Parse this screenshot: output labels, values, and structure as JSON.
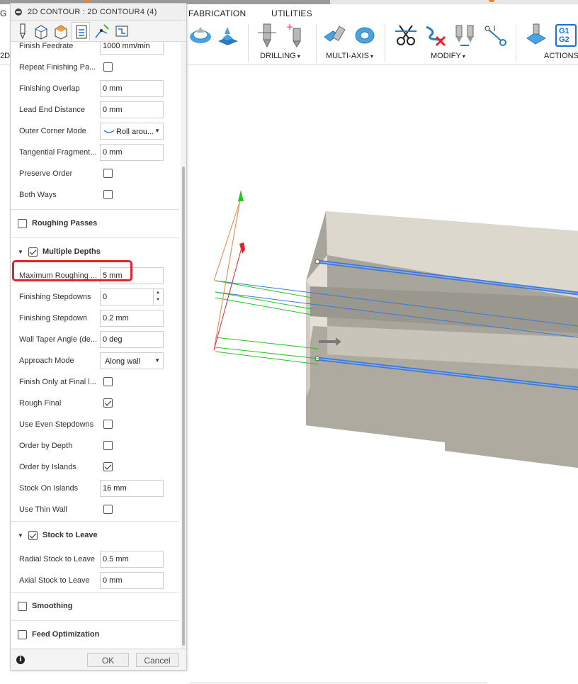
{
  "ribbon": {
    "tabs": [
      "G",
      "FABRICATION",
      "UTILITIES"
    ],
    "side_label": "2D",
    "groups": [
      {
        "label": "DRILLING",
        "caret": "▾"
      },
      {
        "label": "MULTI-AXIS",
        "caret": "▾"
      },
      {
        "label": "MODIFY",
        "caret": "▾"
      },
      {
        "label": "ACTIONS",
        "caret": ""
      }
    ],
    "g1g2": [
      "G1",
      "G2"
    ]
  },
  "panel": {
    "title": "2D CONTOUR : 2D CONTOUR4 (4)",
    "fields": [
      {
        "label": "Finish Feedrate",
        "type": "text",
        "value": "1000 mm/min"
      },
      {
        "label": "Repeat Finishing Pa...",
        "type": "checkbox",
        "checked": false
      },
      {
        "label": "Finishing Overlap",
        "type": "text",
        "value": "0 mm"
      },
      {
        "label": "Lead End Distance",
        "type": "text",
        "value": "0 mm"
      },
      {
        "label": "Outer Corner Mode",
        "type": "select",
        "value": "Roll arou..."
      },
      {
        "label": "Tangential Fragment...",
        "type": "text",
        "value": "0 mm"
      },
      {
        "label": "Preserve Order",
        "type": "checkbox",
        "checked": false
      },
      {
        "label": "Both Ways",
        "type": "checkbox",
        "checked": false
      }
    ],
    "sections": {
      "roughing_passes": {
        "title": "Roughing Passes",
        "checked": false
      },
      "multiple_depths": {
        "title": "Multiple Depths",
        "checked": true
      },
      "stock_to_leave": {
        "title": "Stock to Leave",
        "checked": true
      },
      "smoothing": {
        "title": "Smoothing",
        "checked": false
      },
      "feed_optimization": {
        "title": "Feed Optimization",
        "checked": false
      }
    },
    "depth_fields": [
      {
        "label": "Maximum Roughing ...",
        "type": "text",
        "value": "5 mm"
      },
      {
        "label": "Finishing Stepdowns",
        "type": "spin",
        "value": "0"
      },
      {
        "label": "Finishing Stepdown",
        "type": "text",
        "value": "0.2 mm"
      },
      {
        "label": "Wall Taper Angle (de...",
        "type": "text",
        "value": "0 deg"
      },
      {
        "label": "Approach Mode",
        "type": "select",
        "value": "Along wall"
      },
      {
        "label": "Finish Only at Final l...",
        "type": "checkbox",
        "checked": false
      },
      {
        "label": "Rough Final",
        "type": "checkbox",
        "checked": true
      },
      {
        "label": "Use Even Stepdowns",
        "type": "checkbox",
        "checked": false
      },
      {
        "label": "Order by Depth",
        "type": "checkbox",
        "checked": false
      },
      {
        "label": "Order by Islands",
        "type": "checkbox",
        "checked": true
      },
      {
        "label": "Stock On Islands",
        "type": "text",
        "value": "16 mm"
      },
      {
        "label": "Use Thin Wall",
        "type": "checkbox",
        "checked": false
      }
    ],
    "stock_fields": [
      {
        "label": "Radial Stock to Leave",
        "type": "text",
        "value": "0.5 mm"
      },
      {
        "label": "Axial Stock to Leave",
        "type": "text",
        "value": "0 mm"
      }
    ],
    "footer": {
      "info": "i",
      "ok": "OK",
      "cancel": "Cancel"
    }
  },
  "colors": {
    "highlight": "#e8202a",
    "accent_blue": "#1a6fd1",
    "toolpath_blue": "#3d78d8",
    "lead_green": "#25c425",
    "part": "#d8d3c8"
  }
}
